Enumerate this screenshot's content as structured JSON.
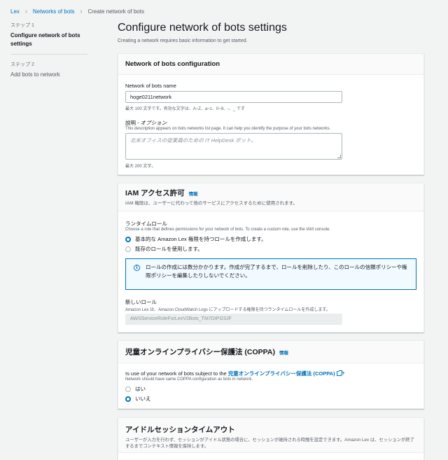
{
  "breadcrumb": {
    "items": [
      "Lex",
      "Networks of bots",
      "Create network of bots"
    ]
  },
  "steps": [
    {
      "number": "ステップ 1",
      "title": "Configure network of bots settings"
    },
    {
      "number": "ステップ 2",
      "title": "Add bots to network"
    }
  ],
  "page": {
    "title": "Configure network of bots settings",
    "description": "Creating a network requires basic information to get started."
  },
  "config": {
    "title": "Network of bots configuration",
    "name_label": "Network of bots name",
    "name_value": "hoge0211network",
    "name_hint": "最大 100 文字です。有効な文字は、A~Z、a~z、0~9、-、_ です",
    "desc_label": "説明 - ",
    "desc_label_optional": "オプション",
    "desc_help": "This description appears on bots networks list page. It can help you identify the purpose of your bots networks.",
    "desc_placeholder": "北米オフィスの従業員のための IT HelpDesk ボット。",
    "desc_hint": "最大 200 文字。"
  },
  "iam": {
    "title": "IAM アクセス許可",
    "info": "情報",
    "subtitle": "IAM 権限は、ユーザーに代わって他のサービスにアクセスするために使用されます。",
    "runtime_label": "ランタイムロール",
    "runtime_desc": "Choose a role that defines permissions for your network of bots. To create a custom role, use the IAM console.",
    "option_create": "基本的な Amazon Lex 権限を持つロールを作成します。",
    "option_existing": "既存のロールを使用します。",
    "info_box": "ロールの作成には数分かかります。作成が完了するまで、ロールを削除したり、このロールの信頼ポリシーや権限ポリシーを編集したりしないでください。",
    "new_role_label": "新しいロール",
    "new_role_desc": "Amazon Lex は、Amazon CloudWatch Logs にアップロードする権限を持つランタイムロールを作成します。",
    "new_role_value": "AWSServiceRoleForLexV2Bots_TM7DIPI23JF"
  },
  "coppa": {
    "title": "児童オンラインプライバシー保護法 (COPPA)",
    "info": "情報",
    "question_prefix": "Is use of your network of bots subject to the ",
    "question_link": "児童オンラインプライバシー保護法 (COPPA)",
    "question_suffix": "?",
    "description": "Network should have same COPPA configuration as bots in network.",
    "option_yes": "はい",
    "option_no": "いいえ"
  },
  "idle": {
    "title": "アイドルセッションタイムアウト",
    "subtitle": "ユーザーが入力を行わず、セッションがアイドル状態の場合に、セッションが維持される時間を設定できます。Amazon Lex は、セッションが終了するまでコンテキスト情報を保持します。"
  }
}
